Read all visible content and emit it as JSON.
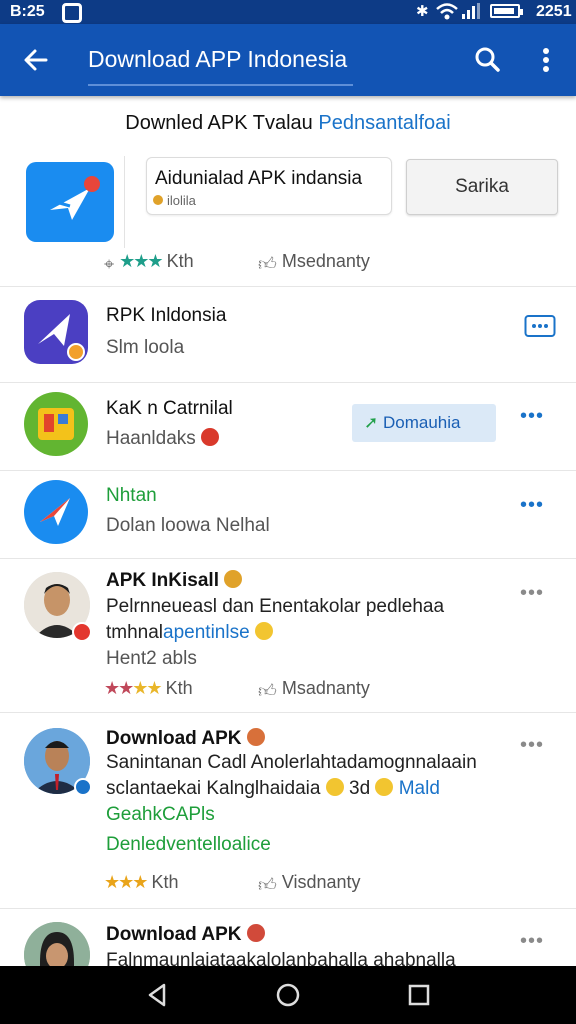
{
  "status": {
    "time": "B:25",
    "battery": "2251"
  },
  "appbar": {
    "title": "Download APP Indonesia"
  },
  "heading": {
    "main": "Downled APK Tvalau",
    "accent": "Pednsantalfoai"
  },
  "hero": {
    "card_title": "Aidunialad APK indansia",
    "card_sub": "ilolila",
    "button_label": "Sarika",
    "meta_left": "Kth",
    "meta_right": "Msednanty"
  },
  "apps": [
    {
      "title": "RPK Inldonsia",
      "subtitle": "Slm loola"
    },
    {
      "title": "KaK n Catrnilal",
      "subtitle": "Haanldaks",
      "button_label": "Domauhia"
    },
    {
      "title": "Nhtan",
      "subtitle": "Dolan loowa Nelhal"
    }
  ],
  "posts": [
    {
      "title": "APK InKisall",
      "line1": "Pelrnneueasl dan Enentakolar pedlehaa",
      "line2a": "tmhnal",
      "line2b": "apentinlse",
      "line3": "Hent2 abls",
      "meta_left": "Kth",
      "meta_right": "Msadnanty"
    },
    {
      "title": "Download APK",
      "line1": "Sanintanan Cadl Anolerlahtadamognnalaain",
      "line2": "sclantaekai Kalnglhaidaia",
      "line2_mid": "3d",
      "line2_accent": "Mald",
      "line3": "GeahkCAPls",
      "line4": "Denledventelloalice",
      "meta_left": "Kth",
      "meta_right": "Visdnanty"
    },
    {
      "title": "Download APK",
      "line1": "Falnmaunlaiataakalolanbahalla ahabnalla"
    }
  ],
  "colors": {
    "appbar": "#1254b4",
    "statusbar": "#0d3b86",
    "accent": "#1a73c9",
    "green": "#1e9e3a"
  }
}
